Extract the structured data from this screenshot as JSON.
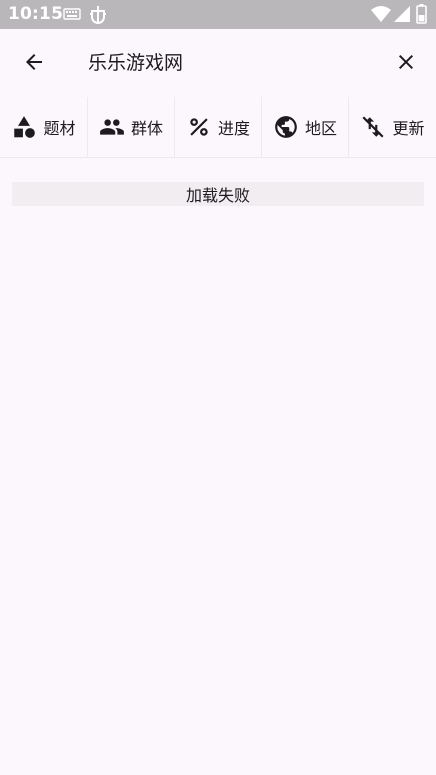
{
  "status_bar": {
    "time": "10:15",
    "icons": [
      "keyboard-icon",
      "bug-icon",
      "wifi-icon",
      "signal-icon",
      "battery-icon"
    ]
  },
  "app_bar": {
    "title": "乐乐游戏网",
    "back_icon": "arrow-left-icon",
    "close_icon": "close-icon"
  },
  "filters": [
    {
      "label": "题材",
      "icon": "shapes-icon"
    },
    {
      "label": "群体",
      "icon": "people-icon"
    },
    {
      "label": "进度",
      "icon": "percent-icon"
    },
    {
      "label": "地区",
      "icon": "globe-icon"
    },
    {
      "label": "更新",
      "icon": "sort-off-icon"
    }
  ],
  "content": {
    "error_message": "加载失败"
  },
  "colors": {
    "background": "#fcf7fd",
    "status_bar": "#bab7bb",
    "text": "#1d1b20",
    "error_box": "#f1edf1"
  }
}
